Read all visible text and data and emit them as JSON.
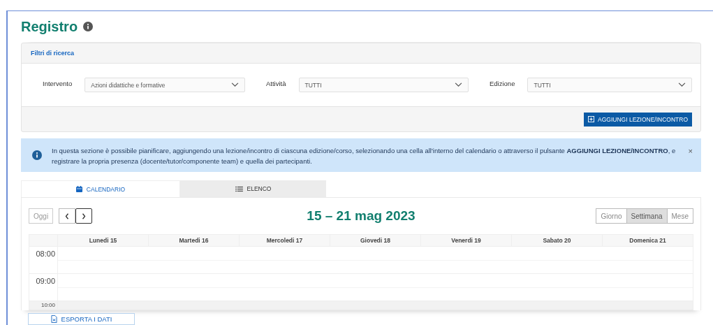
{
  "page": {
    "title": "Registro"
  },
  "filters": {
    "heading": "Filtri di ricerca",
    "fields": [
      {
        "label": "Intervento",
        "value": "Azioni didattiche e formative"
      },
      {
        "label": "Attività",
        "value": "TUTTI"
      },
      {
        "label": "Edizione",
        "value": "TUTTI"
      }
    ],
    "add_button": "AGGIUNGI LEZIONE/INCONTRO"
  },
  "alert": {
    "text": "In questa sezione è possibile pianificare, aggiungendo una lezione/incontro di ciascuna edizione/corso, selezionando una cella all'interno del calendario o attraverso il pulsante **AGGIUNGI LEZIONE/INCONTRO**, e registrare la propria presenza (docente/tutor/componente team) e quella dei partecipanti.",
    "close": "×"
  },
  "tabs": [
    {
      "label": "CALENDARIO",
      "kind": "calendar",
      "selected": true
    },
    {
      "label": "ELENCO",
      "kind": "list",
      "selected": false
    }
  ],
  "calendar": {
    "today_button": {
      "label": "Oggi",
      "disabled": true
    },
    "range_title": "15 – 21 mag 2023",
    "views": [
      {
        "label": "Giorno",
        "selected": false
      },
      {
        "label": "Settimana",
        "selected": true
      },
      {
        "label": "Mese",
        "selected": false
      }
    ],
    "columns": [
      "Lunedi 15",
      "Martedi 16",
      "Mercoledi 17",
      "Giovedi 18",
      "Venerdi 19",
      "Sabato 20",
      "Domenica 21"
    ],
    "time_slots": [
      "08:00",
      "09:00",
      "10:00"
    ]
  },
  "export_button": "ESPORTA I DATI"
}
